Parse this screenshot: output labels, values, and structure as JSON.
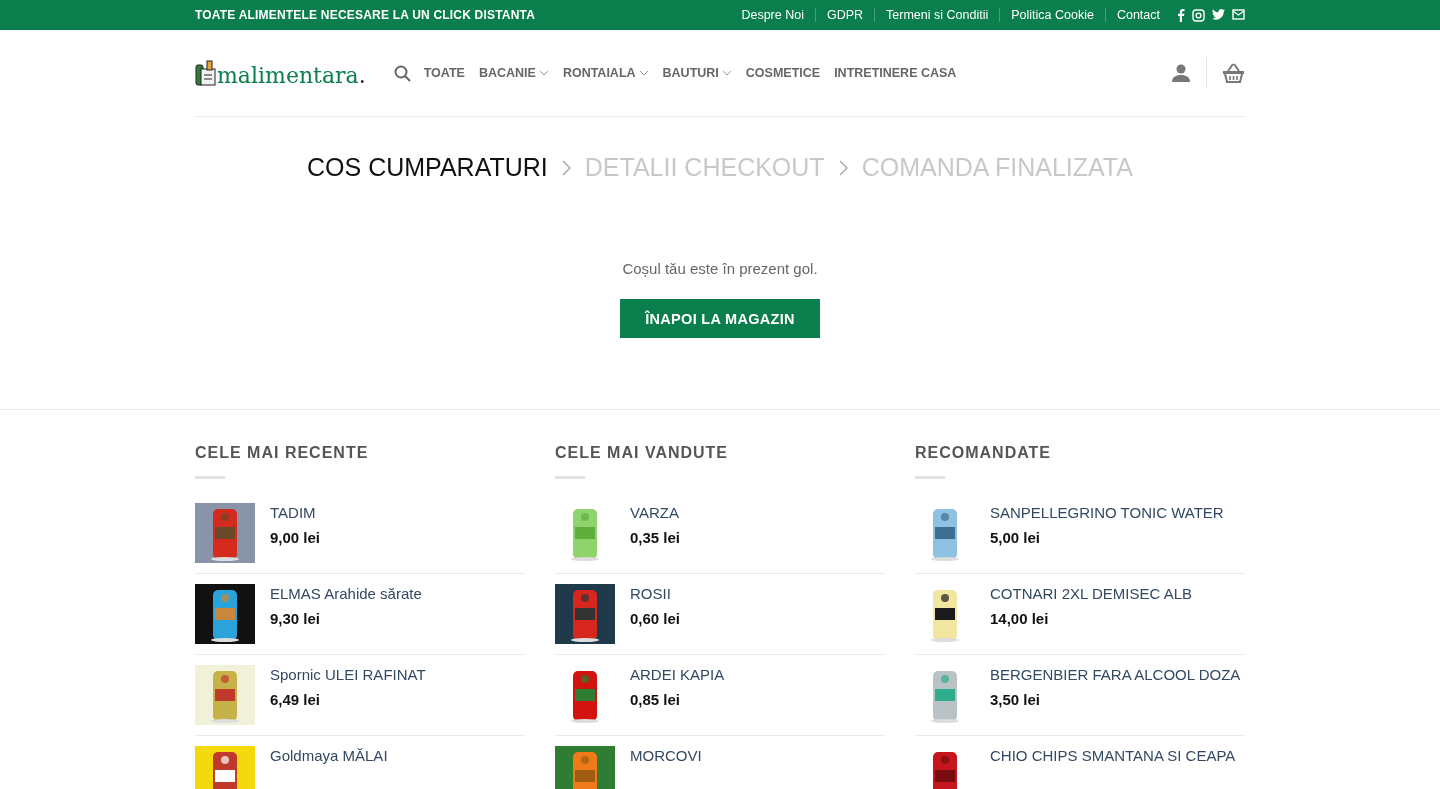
{
  "top_bar": {
    "tagline": "TOATE ALIMENTELE NECESARE LA UN CLICK DISTANTA",
    "links": [
      "Despre Noi",
      "GDPR",
      "Termeni si Conditii",
      "Politica Cookie",
      "Contact"
    ]
  },
  "header": {
    "logo": {
      "name": "malimentara",
      "dot": "."
    },
    "nav": [
      {
        "label": "TOATE",
        "has_menu": false
      },
      {
        "label": "BACANIE",
        "has_menu": true
      },
      {
        "label": "RONTAIALA",
        "has_menu": true
      },
      {
        "label": "BAUTURI",
        "has_menu": true
      },
      {
        "label": "COSMETICE",
        "has_menu": false
      },
      {
        "label": "INTRETINERE CASA",
        "has_menu": false
      }
    ]
  },
  "checkout_steps": [
    {
      "label": "COS CUMPARATURI",
      "selected": true
    },
    {
      "label": "DETALII CHECKOUT",
      "selected": false
    },
    {
      "label": "COMANDA FINALIZATA",
      "selected": false
    }
  ],
  "cart": {
    "message": "Coșul tău este în prezent gol.",
    "button": "ÎNAPOI LA MAGAZIN"
  },
  "product_lists": [
    {
      "title": "CELE MAI RECENTE",
      "items": [
        {
          "name": "TADIM",
          "price": "9,00 lei",
          "kind": "picture"
        },
        {
          "name": "ELMAS Arahide sărate",
          "price": "9,30 lei",
          "kind": "picture"
        },
        {
          "name": "Spornic ULEI RAFINAT",
          "price": "6,49 lei",
          "kind": "picture"
        },
        {
          "name": "Goldmaya MĂLAI",
          "kind": "picture"
        }
      ]
    },
    {
      "title": "CELE MAI VANDUTE",
      "items": [
        {
          "name": "VARZA",
          "price": "0,35 lei",
          "kind": "picture"
        },
        {
          "name": "ROSII",
          "price": "0,60 lei",
          "kind": "picture"
        },
        {
          "name": "ARDEI KAPIA",
          "price": "0,85 lei",
          "kind": "picture"
        },
        {
          "name": "MORCOVI",
          "kind": "picture"
        }
      ]
    },
    {
      "title": "RECOMANDATE",
      "items": [
        {
          "name": "SANPELLEGRINO TONIC WATER",
          "price": "5,00 lei",
          "kind": "picture"
        },
        {
          "name": "COTNARI 2XL DEMISEC ALB",
          "price": "14,00 lei",
          "kind": "picture"
        },
        {
          "name": "BERGENBIER FARA ALCOOL DOZA",
          "price": "3,50 lei",
          "kind": "picture"
        },
        {
          "name": "CHIO CHIPS SMANTANA SI CEAPA",
          "kind": "picture"
        }
      ]
    }
  ]
}
